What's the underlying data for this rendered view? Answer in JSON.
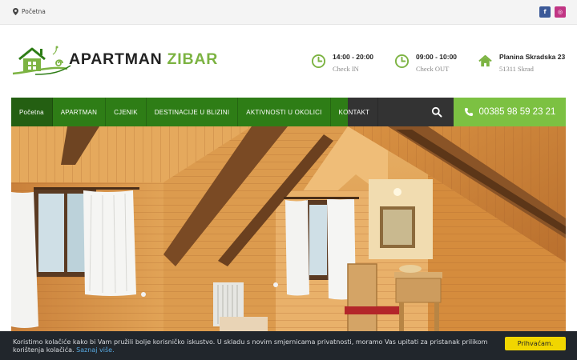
{
  "topbar": {
    "breadcrumb": "Početna",
    "social": [
      {
        "icon": "facebook-icon",
        "glyph": "f",
        "color": "#3b5998"
      },
      {
        "icon": "instagram-icon",
        "glyph": "◎",
        "color": "#c13584"
      }
    ]
  },
  "logo": {
    "word1": "APARTMAN",
    "word2": "ZIBAR"
  },
  "info": {
    "checkin": {
      "time": "14:00 - 20:00",
      "label": "Check IN"
    },
    "checkout": {
      "time": "09:00 - 10:00",
      "label": "Check OUT"
    },
    "address": {
      "street": "Planina Skradska 23",
      "city": "51311 Skrad"
    }
  },
  "nav": {
    "items": [
      "Početna",
      "APARTMAN",
      "CJENIK",
      "DESTINACIJE U BLIZINI",
      "AKTIVNOSTI U OKOLICI",
      "KONTAKT"
    ],
    "phone": "00385 98 59 23 21"
  },
  "cookie": {
    "text": "Koristimo kolačiće kako bi Vam pružili bolje korisničko iskustvo. U skladu s novim smjernicama privatnosti, moramo Vas upitati za pristanak prilikom korištenja kolačića.",
    "link": "Saznaj više.",
    "button": "Prihvaćam."
  },
  "colors": {
    "accent_green": "#7cb342",
    "nav_green": "#2e7d16",
    "phone_green": "#7cc142",
    "nav_dark": "#333333",
    "cookie_bg": "#21262c",
    "cookie_button": "#f1d600"
  }
}
